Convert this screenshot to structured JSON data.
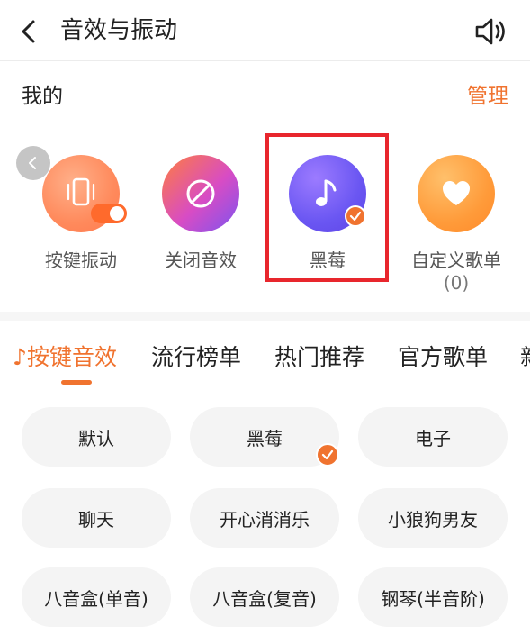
{
  "header": {
    "title": "音效与振动",
    "icons": {
      "back": "chevron-left-icon",
      "speaker": "speaker-icon"
    }
  },
  "my": {
    "title": "我的",
    "manage_label": "管理",
    "items": [
      {
        "label": "按键振动",
        "icon": "phone-vibrate-icon",
        "toggle_on": true
      },
      {
        "label": "关闭音效",
        "icon": "no-sound-icon"
      },
      {
        "label": "黑莓",
        "icon": "music-note-icon",
        "selected": true
      },
      {
        "label": "自定义歌单",
        "sub": "(0)",
        "icon": "heart-icon"
      }
    ]
  },
  "tabs": [
    {
      "label": "♪按键音效",
      "active": true
    },
    {
      "label": "流行榜单"
    },
    {
      "label": "热门推荐"
    },
    {
      "label": "官方歌单"
    },
    {
      "label": "新"
    }
  ],
  "sounds": [
    {
      "label": "默认"
    },
    {
      "label": "黑莓",
      "selected": true
    },
    {
      "label": "电子"
    },
    {
      "label": "聊天"
    },
    {
      "label": "开心消消乐"
    },
    {
      "label": "小狼狗男友"
    },
    {
      "label": "八音盒(单音)"
    },
    {
      "label": "八音盒(复音)"
    },
    {
      "label": "钢琴(半音阶)"
    }
  ],
  "colors": {
    "accent": "#f0732f",
    "highlight": "#e8262d"
  }
}
